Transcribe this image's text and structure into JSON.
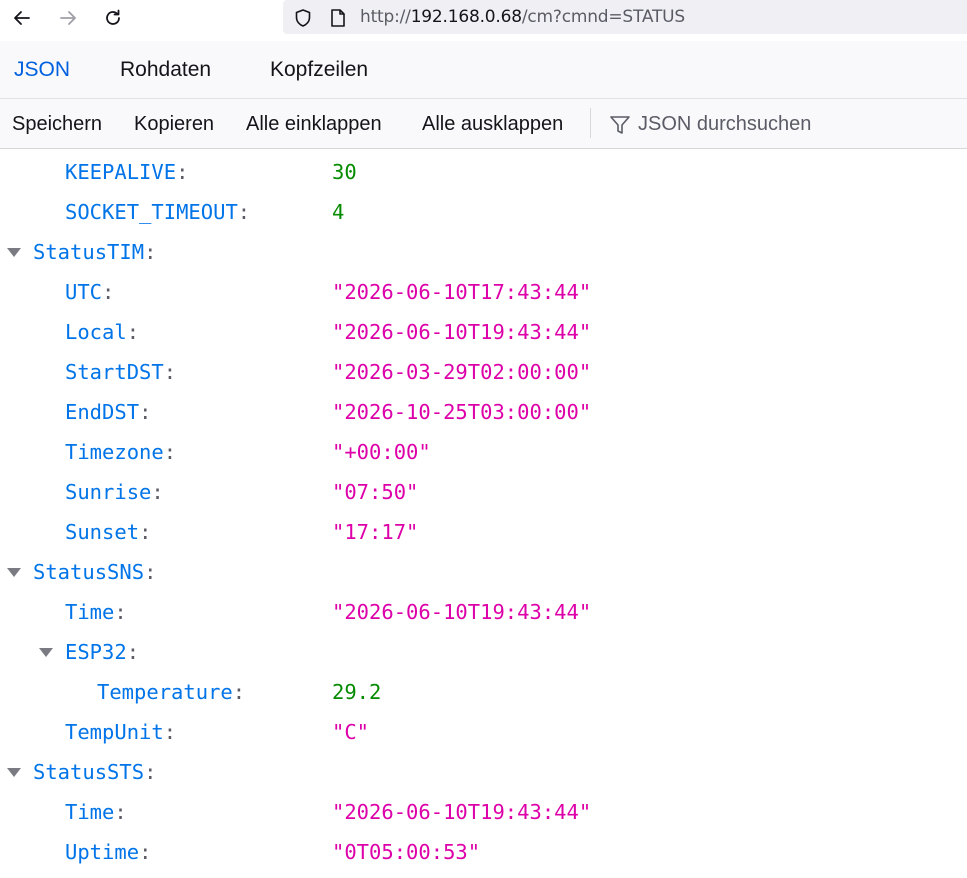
{
  "browser": {
    "url_prefix": "http://",
    "url_host": "192.168.0.68",
    "url_rest": "/cm?cmnd=STATUS"
  },
  "tabs": [
    {
      "label": "JSON",
      "active": true
    },
    {
      "label": "Rohdaten",
      "active": false
    },
    {
      "label": "Kopfzeilen",
      "active": false
    }
  ],
  "toolbar": {
    "save": "Speichern",
    "copy": "Kopieren",
    "collapse_all": "Alle einklappen",
    "expand_all": "Alle ausklappen",
    "filter_placeholder": "JSON durchsuchen"
  },
  "colors": {
    "key": "#0074e8",
    "string": "#dd00a9",
    "number": "#058b00",
    "accent": "#0060df"
  },
  "tree": [
    {
      "key": "KEEPALIVE",
      "value": "30",
      "type": "num",
      "depth": 1
    },
    {
      "key": "SOCKET_TIMEOUT",
      "value": "4",
      "type": "num",
      "depth": 1
    },
    {
      "key": "StatusTIM",
      "value": "",
      "type": "obj",
      "depth": 0,
      "expanded": true
    },
    {
      "key": "UTC",
      "value": "\"2026-06-10T17:43:44\"",
      "type": "str",
      "depth": 1
    },
    {
      "key": "Local",
      "value": "\"2026-06-10T19:43:44\"",
      "type": "str",
      "depth": 1
    },
    {
      "key": "StartDST",
      "value": "\"2026-03-29T02:00:00\"",
      "type": "str",
      "depth": 1
    },
    {
      "key": "EndDST",
      "value": "\"2026-10-25T03:00:00\"",
      "type": "str",
      "depth": 1
    },
    {
      "key": "Timezone",
      "value": "\"+00:00\"",
      "type": "str",
      "depth": 1
    },
    {
      "key": "Sunrise",
      "value": "\"07:50\"",
      "type": "str",
      "depth": 1
    },
    {
      "key": "Sunset",
      "value": "\"17:17\"",
      "type": "str",
      "depth": 1
    },
    {
      "key": "StatusSNS",
      "value": "",
      "type": "obj",
      "depth": 0,
      "expanded": true
    },
    {
      "key": "Time",
      "value": "\"2026-06-10T19:43:44\"",
      "type": "str",
      "depth": 1
    },
    {
      "key": "ESP32",
      "value": "",
      "type": "obj",
      "depth": 1,
      "expanded": true
    },
    {
      "key": "Temperature",
      "value": "29.2",
      "type": "num",
      "depth": 2
    },
    {
      "key": "TempUnit",
      "value": "\"C\"",
      "type": "str",
      "depth": 1
    },
    {
      "key": "StatusSTS",
      "value": "",
      "type": "obj",
      "depth": 0,
      "expanded": true
    },
    {
      "key": "Time",
      "value": "\"2026-06-10T19:43:44\"",
      "type": "str",
      "depth": 1
    },
    {
      "key": "Uptime",
      "value": "\"0T05:00:53\"",
      "type": "str",
      "depth": 1
    }
  ]
}
